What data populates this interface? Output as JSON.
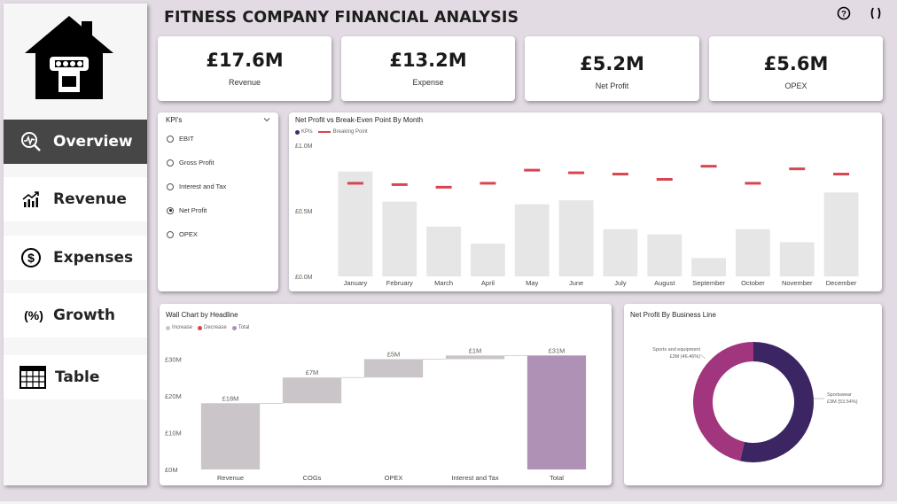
{
  "title": "FITNESS COMPANY FINANCIAL ANALYSIS",
  "nav": {
    "overview": "Overview",
    "revenue": "Revenue",
    "expenses": "Expenses",
    "growth": "Growth",
    "table": "Table"
  },
  "kpis": [
    {
      "value": "£17.6M",
      "label": "Revenue"
    },
    {
      "value": "£13.2M",
      "label": "Expense"
    },
    {
      "value": "£5.2M",
      "label": "Net Profit"
    },
    {
      "value": "£5.6M",
      "label": "OPEX"
    }
  ],
  "slicer": {
    "title": "KPI's",
    "options": [
      "EBIT",
      "Gross Profit",
      "Interest and Tax",
      "Net Profit",
      "OPEX"
    ],
    "selected": "Net Profit"
  },
  "icons": {
    "help": "help-circle-icon",
    "focus": "focus-mode-icon",
    "logo": "house-dumbbell-icon",
    "overview": "search-chart-icon",
    "revenue": "growth-bars-icon",
    "expenses": "dollar-circle-icon",
    "growth": "percent-icon",
    "table": "table-grid-icon",
    "slicer_chevron": "chevron-down-icon"
  },
  "colors": {
    "active_nav": "#464646",
    "bar": "#e6e6e6",
    "break_even": "#d64550",
    "kpi_dot": "#3b2e6b",
    "increase": "#c9c5c9",
    "decrease": "#d64550",
    "total": "#ae91b5",
    "donut_sportswear": "#3b2563",
    "donut_sports_equipment": "#a1357e"
  },
  "chart_data": [
    {
      "type": "bar",
      "title": "Net Profit vs Break-Even Point By Month",
      "legend": [
        "KPIs",
        "Breaking Point"
      ],
      "categories": [
        "January",
        "February",
        "March",
        "April",
        "May",
        "June",
        "July",
        "August",
        "September",
        "October",
        "November",
        "December"
      ],
      "series": [
        {
          "name": "KPIs",
          "values": [
            0.8,
            0.57,
            0.38,
            0.25,
            0.55,
            0.58,
            0.36,
            0.32,
            0.14,
            0.36,
            0.26,
            0.64
          ]
        },
        {
          "name": "Breaking Point",
          "values": [
            0.71,
            0.7,
            0.68,
            0.71,
            0.81,
            0.79,
            0.78,
            0.74,
            0.84,
            0.71,
            0.82,
            0.78
          ]
        }
      ],
      "ylim": [
        0,
        1.0
      ],
      "yticks": [
        "£0.0M",
        "£0.5M",
        "£1.0M"
      ],
      "ytick_values": [
        0,
        0.5,
        1.0
      ],
      "legend_position": "top-left"
    },
    {
      "type": "bar",
      "subtype": "waterfall",
      "title": "Wall Chart by Headline",
      "legend": [
        "Increase",
        "Decrease",
        "Total"
      ],
      "categories": [
        "Revenue",
        "COGs",
        "OPEX",
        "Interest and Tax",
        "Total"
      ],
      "values": [
        18,
        7,
        5,
        1,
        31
      ],
      "kinds": [
        "increase",
        "increase",
        "increase",
        "increase",
        "total"
      ],
      "data_labels": [
        "£18M",
        "£7M",
        "£5M",
        "£1M",
        "£31M"
      ],
      "ylim": [
        0,
        33
      ],
      "yticks": [
        "£0M",
        "£10M",
        "£20M",
        "£30M"
      ],
      "ytick_values": [
        0,
        10,
        20,
        30
      ],
      "legend_position": "top-left"
    },
    {
      "type": "pie",
      "subtype": "donut",
      "title": "Net Profit By Business Line",
      "slices": [
        {
          "name": "Sportswear",
          "value": 53.54,
          "label_line1": "Sportswear",
          "label_line2": "£3M (53.54%)"
        },
        {
          "name": "Sports and equipment",
          "value": 46.46,
          "label_line1": "Sports and equipment",
          "label_line2": "£3M (46.46%)"
        }
      ]
    }
  ]
}
